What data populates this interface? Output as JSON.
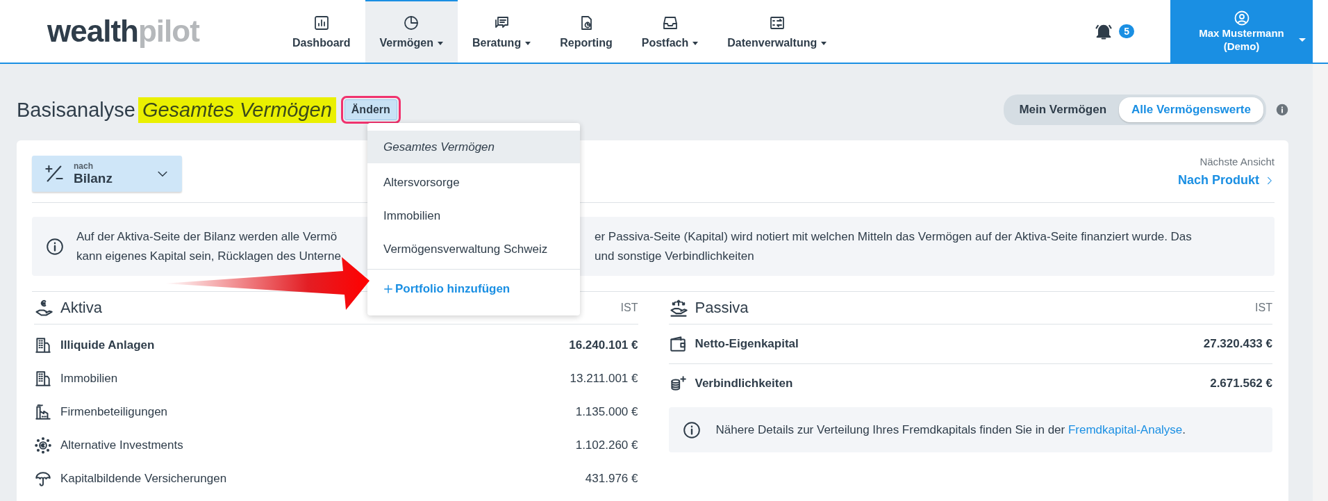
{
  "logo": {
    "first": "wealth",
    "second": "pilot"
  },
  "nav": [
    {
      "label": "Dashboard",
      "kind": "chart",
      "menu": false,
      "selected": false
    },
    {
      "label": "Vermögen",
      "kind": "pie",
      "menu": true,
      "selected": true
    },
    {
      "label": "Beratung",
      "kind": "chat",
      "menu": true,
      "selected": false
    },
    {
      "label": "Reporting",
      "kind": "report",
      "menu": false,
      "selected": false
    },
    {
      "label": "Postfach",
      "kind": "inbox",
      "menu": true,
      "selected": false
    },
    {
      "label": "Datenverwaltung",
      "kind": "data",
      "menu": true,
      "selected": false
    }
  ],
  "notifications": {
    "count": "5"
  },
  "user": {
    "name": "Max Mustermann",
    "note": "(Demo)"
  },
  "page_title": {
    "label": "Basisanalyse",
    "portfolio": "Gesamtes Vermögen",
    "highlighted": true,
    "change_button": "Ändern",
    "button_outlined": true
  },
  "view_toggle": [
    {
      "label": "Mein Vermögen",
      "selected": false
    },
    {
      "label": "Alle Vermögenswerte",
      "selected": true
    }
  ],
  "grouping": {
    "caption": "nach",
    "value": "Bilanz"
  },
  "next_view": {
    "caption": "Nächste Ansicht",
    "link": "Nach Produkt"
  },
  "info": {
    "line_1_start": "Auf der Aktiva-Seite der Bilanz werden alle Vermö",
    "line_1_end": "er Passiva-Seite (Kapital) wird notiert mit welchen Mitteln das Vermögen auf der Aktiva-Seite finanziert wurde. Das",
    "line_2_start": "kann eigenes Kapital sein, Rücklagen des Unterne",
    "line_2_end": "und sonstige Verbindlichkeiten"
  },
  "portfolio_menu": {
    "items": [
      {
        "label": "Gesamtes Vermögen",
        "selected": true
      },
      {
        "label": "Altersvorsorge",
        "selected": false
      },
      {
        "label": "Immobilien",
        "selected": false
      },
      {
        "label": "Vermögensverwaltung Schweiz",
        "selected": false
      }
    ],
    "add": "Portfolio hinzufügen"
  },
  "aktiva": {
    "title": "Aktiva",
    "column": "IST",
    "rows": [
      {
        "label": "Illiquide Anlagen",
        "value": "16.240.101 €",
        "emphasis": true,
        "kind": "building"
      },
      {
        "label": "Immobilien",
        "value": "13.211.001 €",
        "emphasis": false,
        "kind": "building"
      },
      {
        "label": "Firmenbeteiligungen",
        "value": "1.135.000 €",
        "emphasis": false,
        "kind": "factory"
      },
      {
        "label": "Alternative Investments",
        "value": "1.102.260 €",
        "emphasis": false,
        "kind": "coin"
      },
      {
        "label": "Kapitalbildende Versicherungen",
        "value": "431.976 €",
        "emphasis": false,
        "kind": "umbrella"
      }
    ]
  },
  "passiva": {
    "title": "Passiva",
    "column": "IST",
    "rows": [
      {
        "label": "Netto-Eigenkapital",
        "value": "27.320.433 €",
        "emphasis": true,
        "kind": "wallet"
      },
      {
        "label": "Verbindlichkeiten",
        "value": "2.671.562 €",
        "emphasis": true,
        "kind": "coins"
      }
    ],
    "note": {
      "text": "Nähere Details zur Verteilung Ihres Fremdkapitals finden Sie in der ",
      "link": "Fremdkapital-Analyse",
      "end": "."
    }
  }
}
